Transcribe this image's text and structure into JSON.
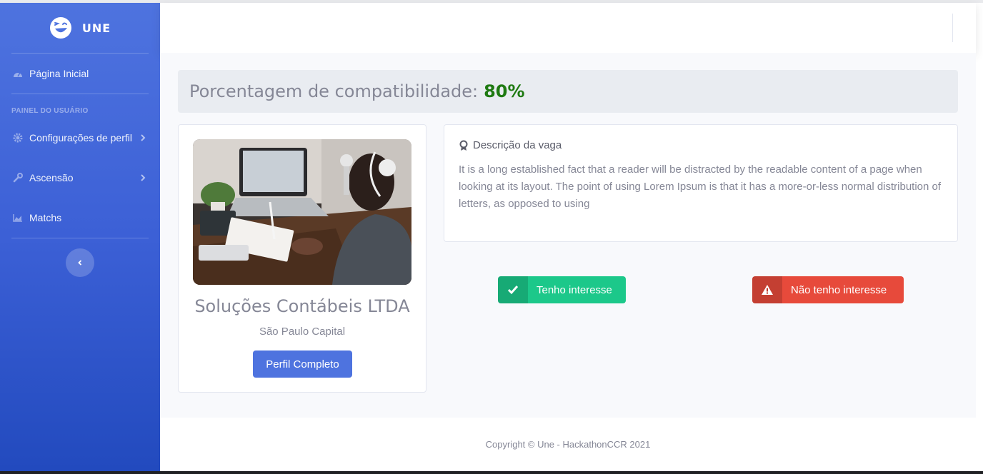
{
  "brand": {
    "name": "UNE"
  },
  "sidebar": {
    "home_label": "Página Inicial",
    "heading": "PAINEL DO USUÁRIO",
    "items": [
      {
        "label": "Configurações de perfil",
        "icon": "gear-icon",
        "has_submenu": true
      },
      {
        "label": "Ascensão",
        "icon": "wrench-icon",
        "has_submenu": true
      },
      {
        "label": "Matchs",
        "icon": "area-chart-icon",
        "has_submenu": false
      }
    ],
    "toggle_icon": "chevron-left-icon"
  },
  "compat": {
    "label": "Porcentagem de compatibilidade:",
    "value": "80%"
  },
  "company": {
    "name": "Soluções Contábeis LTDA",
    "location": "São Paulo Capital",
    "profile_button": "Perfil Completo"
  },
  "description": {
    "title": "Descrição da vaga",
    "text": "It is a long established fact that a reader will be distracted by the readable content of a page when looking at its layout. The point of using Lorem Ipsum is that it has a more-or-less normal distribution of letters, as opposed to using"
  },
  "actions": {
    "interest": "Tenho interesse",
    "no_interest": "Não tenho interesse"
  },
  "footer": {
    "copyright": "Copyright © Une - HackathonCCR 2021"
  },
  "colors": {
    "primary": "#4e73df",
    "success": "#1cc88a",
    "danger": "#e74a3b",
    "compat_value": "#1f7a12"
  }
}
